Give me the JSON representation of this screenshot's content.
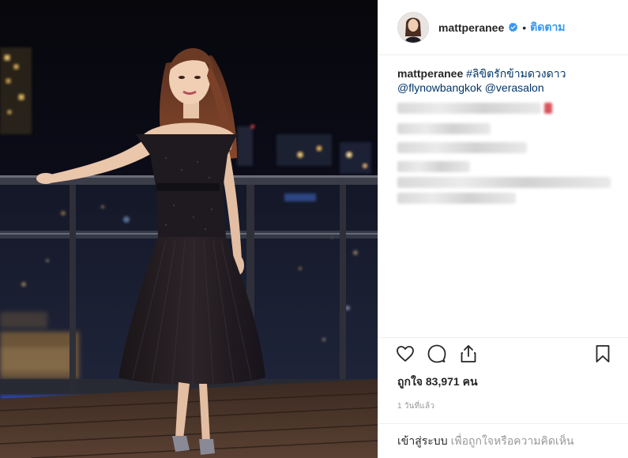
{
  "post": {
    "username": "mattperanee",
    "follow_label": "ติดตาม",
    "separator": "•",
    "caption_user": "mattperanee",
    "hashtag": "#ลิขิตรักข้ามดวงดาว",
    "mention_1": "@flynowbangkok",
    "mention_2": "@verasalon",
    "likes_label": "ถูกใจ 83,971 คน",
    "time_ago": "1 วันที่แล้ว",
    "login_link": "เข้าสู่ระบบ",
    "login_rest": "เพื่อถูกใจหรือความคิดเห็น"
  },
  "icons": {
    "verified": "verified-badge-icon",
    "like": "heart-icon",
    "comment": "comment-bubble-icon",
    "share": "share-icon",
    "save": "bookmark-icon"
  },
  "colors": {
    "link_blue": "#3897f0",
    "hashtag_blue": "#003569",
    "muted_gray": "#999999",
    "divider": "#efefef"
  }
}
